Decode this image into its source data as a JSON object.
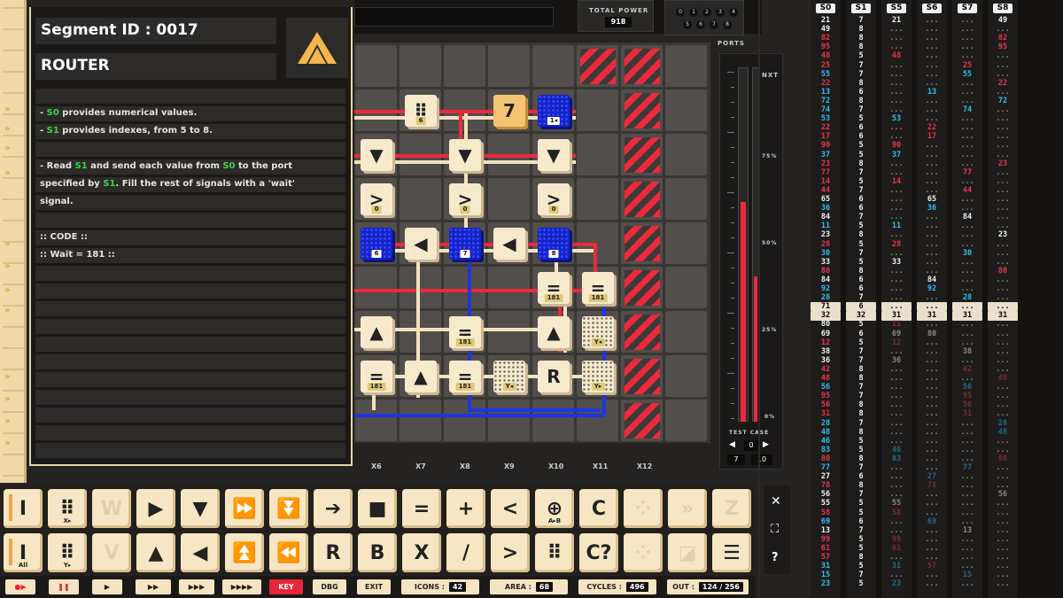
{
  "info": {
    "segment": "Segment ID : 0017",
    "name": "ROUTER",
    "lines": [
      {
        "pre": "- ",
        "g": "S0",
        "post": " provides numerical values."
      },
      {
        "pre": "- ",
        "g": "S1",
        "post": " provides indexes, from 5 to 8."
      },
      {
        "pre": "- Read ",
        "g": "S1",
        "post": " and send each value from "
      },
      {
        "pre": "specified by ",
        "g": "S1",
        "post": ". Fill the rest of signals with a 'wait'"
      },
      {
        "pre": "signal.",
        "g": "",
        "post": ""
      }
    ],
    "line3_g2": "S0",
    "line3_post2": " to the port",
    "code_header": ":: CODE ::",
    "code_line": ":: Wait = 181 ::"
  },
  "top": {
    "total_power_label": "TOTAL POWER",
    "total_power": "918",
    "ports_label": "PORTS",
    "port_digits": [
      "0",
      "1",
      "2",
      "3",
      "4",
      "5",
      "6",
      "7",
      "8"
    ]
  },
  "grid": {
    "columns": [
      "X6",
      "X7",
      "X8",
      "X9",
      "X10",
      "X11",
      "X12"
    ],
    "tiles": [
      {
        "id": "t1",
        "glyph": "⠿",
        "sub": "6",
        "cls": "",
        "c": 1,
        "r": 1
      },
      {
        "id": "t2",
        "glyph": "7",
        "sub": "",
        "cls": "orange",
        "c": 3,
        "r": 1
      },
      {
        "id": "t3",
        "glyph": "",
        "sub": "1◂",
        "cls": "blue",
        "c": 4,
        "r": 1
      },
      {
        "id": "t4",
        "glyph": "▼",
        "sub": "",
        "cls": "",
        "c": 0,
        "r": 2
      },
      {
        "id": "t5",
        "glyph": "▼",
        "sub": "",
        "cls": "",
        "c": 2,
        "r": 2
      },
      {
        "id": "t6",
        "glyph": "▼",
        "sub": "",
        "cls": "",
        "c": 4,
        "r": 2
      },
      {
        "id": "t7",
        "glyph": ">",
        "sub": "0",
        "cls": "",
        "c": 0,
        "r": 3
      },
      {
        "id": "t8",
        "glyph": ">",
        "sub": "0",
        "cls": "",
        "c": 2,
        "r": 3
      },
      {
        "id": "t9",
        "glyph": ">",
        "sub": "0",
        "cls": "",
        "c": 4,
        "r": 3
      },
      {
        "id": "t10",
        "glyph": "",
        "sub": "6",
        "cls": "blue",
        "c": 0,
        "r": 4
      },
      {
        "id": "t11",
        "glyph": "◀",
        "sub": "",
        "cls": "",
        "c": 1,
        "r": 4
      },
      {
        "id": "t12",
        "glyph": "",
        "sub": "7",
        "cls": "blue",
        "c": 2,
        "r": 4
      },
      {
        "id": "t13",
        "glyph": "◀",
        "sub": "",
        "cls": "",
        "c": 3,
        "r": 4
      },
      {
        "id": "t14",
        "glyph": "",
        "sub": "8",
        "cls": "blue",
        "c": 4,
        "r": 4
      },
      {
        "id": "t15",
        "glyph": "=",
        "sub": "181",
        "cls": "",
        "c": 4,
        "r": 5
      },
      {
        "id": "t16",
        "glyph": "=",
        "sub": "181",
        "cls": "",
        "c": 5,
        "r": 5
      },
      {
        "id": "t17",
        "glyph": "▲",
        "sub": "",
        "cls": "",
        "c": 0,
        "r": 6
      },
      {
        "id": "t18",
        "glyph": "=",
        "sub": "181",
        "cls": "",
        "c": 2,
        "r": 6
      },
      {
        "id": "t19",
        "glyph": "▲",
        "sub": "",
        "cls": "",
        "c": 4,
        "r": 6
      },
      {
        "id": "t20",
        "glyph": "",
        "sub": "Y◂",
        "cls": "dots",
        "c": 5,
        "r": 6
      },
      {
        "id": "t21",
        "glyph": "=",
        "sub": "181",
        "cls": "",
        "c": 0,
        "r": 7
      },
      {
        "id": "t22",
        "glyph": "▲",
        "sub": "",
        "cls": "",
        "c": 1,
        "r": 7
      },
      {
        "id": "t23",
        "glyph": "=",
        "sub": "181",
        "cls": "",
        "c": 2,
        "r": 7
      },
      {
        "id": "t24",
        "glyph": "",
        "sub": "Y◂",
        "cls": "dots",
        "c": 3,
        "r": 7
      },
      {
        "id": "t25",
        "glyph": "R",
        "sub": "",
        "cls": "",
        "c": 4,
        "r": 7
      },
      {
        "id": "t26",
        "glyph": "",
        "sub": "Y▸",
        "cls": "dots",
        "c": 5,
        "r": 7
      }
    ]
  },
  "gauge": {
    "label": "NXT",
    "ticks": [
      "75%",
      "50%",
      "25%",
      "0%"
    ],
    "fill": 0.62,
    "fill2": 0.41,
    "test_case_label": "TEST CASE",
    "test_case": "0",
    "tc_a": "7",
    "tc_b": "10"
  },
  "signals": [
    {
      "h": "S0",
      "v": [
        [
          "21",
          "w"
        ],
        [
          "49",
          "w"
        ],
        [
          "82",
          "r"
        ],
        [
          "95",
          "r"
        ],
        [
          "48",
          "r"
        ],
        [
          "25",
          "r"
        ],
        [
          "55",
          "c"
        ],
        [
          "22",
          "r"
        ],
        [
          "13",
          "c"
        ],
        [
          "72",
          "c"
        ],
        [
          "74",
          "c"
        ],
        [
          "53",
          "c"
        ],
        [
          "22",
          "r"
        ],
        [
          "17",
          "r"
        ],
        [
          "90",
          "r"
        ],
        [
          "37",
          "c"
        ],
        [
          "23",
          "r"
        ],
        [
          "77",
          "r"
        ],
        [
          "14",
          "r"
        ],
        [
          "44",
          "r"
        ],
        [
          "65",
          "w"
        ],
        [
          "36",
          "c"
        ],
        [
          "84",
          "w"
        ],
        [
          "11",
          "c"
        ],
        [
          "23",
          "w"
        ],
        [
          "28",
          "r"
        ],
        [
          "30",
          "c"
        ],
        [
          "33",
          "w"
        ],
        [
          "80",
          "r"
        ],
        [
          "84",
          "w"
        ],
        [
          "92",
          "c"
        ],
        [
          "28",
          "c"
        ],
        [
          "71",
          "box"
        ],
        [
          "32",
          "box"
        ],
        [
          "80",
          "w"
        ],
        [
          "69",
          "w"
        ],
        [
          "12",
          "r"
        ],
        [
          "38",
          "w"
        ],
        [
          "36",
          "w"
        ],
        [
          "42",
          "r"
        ],
        [
          "48",
          "r"
        ],
        [
          "56",
          "c"
        ],
        [
          "95",
          "r"
        ],
        [
          "56",
          "r"
        ],
        [
          "31",
          "r"
        ],
        [
          "28",
          "c"
        ],
        [
          "48",
          "c"
        ],
        [
          "46",
          "c"
        ],
        [
          "83",
          "c"
        ],
        [
          "80",
          "r"
        ],
        [
          "77",
          "c"
        ],
        [
          "27",
          "w"
        ],
        [
          "78",
          "r"
        ],
        [
          "56",
          "w"
        ],
        [
          "55",
          "w"
        ],
        [
          "58",
          "r"
        ],
        [
          "69",
          "c"
        ],
        [
          "13",
          "w"
        ],
        [
          "99",
          "r"
        ],
        [
          "61",
          "r"
        ],
        [
          "57",
          "r"
        ],
        [
          "31",
          "c"
        ],
        [
          "15",
          "c"
        ],
        [
          "23",
          "c"
        ]
      ]
    },
    {
      "h": "S1",
      "v": [
        [
          "7",
          "w"
        ],
        [
          "8",
          "w"
        ],
        [
          "8",
          "w"
        ],
        [
          "8",
          "w"
        ],
        [
          "5",
          "w"
        ],
        [
          "7",
          "w"
        ],
        [
          "7",
          "w"
        ],
        [
          "8",
          "w"
        ],
        [
          "6",
          "w"
        ],
        [
          "8",
          "w"
        ],
        [
          "7",
          "w"
        ],
        [
          "5",
          "w"
        ],
        [
          "6",
          "w"
        ],
        [
          "6",
          "w"
        ],
        [
          "5",
          "w"
        ],
        [
          "5",
          "w"
        ],
        [
          "8",
          "w"
        ],
        [
          "7",
          "w"
        ],
        [
          "5",
          "w"
        ],
        [
          "7",
          "w"
        ],
        [
          "6",
          "w"
        ],
        [
          "6",
          "w"
        ],
        [
          "7",
          "w"
        ],
        [
          "5",
          "w"
        ],
        [
          "8",
          "w"
        ],
        [
          "5",
          "w"
        ],
        [
          "7",
          "w"
        ],
        [
          "5",
          "w"
        ],
        [
          "8",
          "w"
        ],
        [
          "6",
          "w"
        ],
        [
          "6",
          "w"
        ],
        [
          "7",
          "w"
        ],
        [
          "6",
          "box"
        ],
        [
          "32",
          "box"
        ],
        [
          "5",
          "w"
        ],
        [
          "6",
          "w"
        ],
        [
          "5",
          "w"
        ],
        [
          "7",
          "w"
        ],
        [
          "7",
          "w"
        ],
        [
          "8",
          "w"
        ],
        [
          "8",
          "w"
        ],
        [
          "7",
          "w"
        ],
        [
          "7",
          "w"
        ],
        [
          "8",
          "w"
        ],
        [
          "8",
          "w"
        ],
        [
          "7",
          "w"
        ],
        [
          "8",
          "w"
        ],
        [
          "5",
          "w"
        ],
        [
          "5",
          "w"
        ],
        [
          "8",
          "w"
        ],
        [
          "7",
          "w"
        ],
        [
          "6",
          "w"
        ],
        [
          "8",
          "w"
        ],
        [
          "7",
          "w"
        ],
        [
          "5",
          "w"
        ],
        [
          "5",
          "w"
        ],
        [
          "6",
          "w"
        ],
        [
          "7",
          "w"
        ],
        [
          "5",
          "w"
        ],
        [
          "5",
          "w"
        ],
        [
          "8",
          "w"
        ],
        [
          "5",
          "w"
        ],
        [
          "7",
          "w"
        ],
        [
          "5",
          "w"
        ]
      ]
    }
  ],
  "signals_other": [
    {
      "h": "S5",
      "cur": "31",
      "rows": {
        "0": [
          "21",
          "w"
        ],
        "4": [
          "48",
          "r"
        ],
        "11": [
          "53",
          "c"
        ],
        "14": [
          "90",
          "r"
        ],
        "15": [
          "37",
          "c"
        ],
        "18": [
          "14",
          "r"
        ],
        "23": [
          "11",
          "c"
        ],
        "25": [
          "28",
          "r"
        ],
        "27": [
          "33",
          "w"
        ],
        "34": [
          "11",
          "dr"
        ],
        "35": [
          "69",
          "gr"
        ],
        "36": [
          "12",
          "dr"
        ],
        "38": [
          "36",
          "gr"
        ],
        "48": [
          "46",
          "dc"
        ],
        "49": [
          "83",
          "dc"
        ],
        "54": [
          "55",
          "gr"
        ],
        "55": [
          "58",
          "dr"
        ],
        "58": [
          "99",
          "dr"
        ],
        "59": [
          "61",
          "dr"
        ],
        "61": [
          "31",
          "dc"
        ],
        "63": [
          "23",
          "dc"
        ]
      }
    },
    {
      "h": "S6",
      "cur": "31",
      "rows": {
        "8": [
          "13",
          "c"
        ],
        "12": [
          "22",
          "r"
        ],
        "13": [
          "17",
          "r"
        ],
        "20": [
          "65",
          "w"
        ],
        "21": [
          "36",
          "c"
        ],
        "29": [
          "84",
          "w"
        ],
        "30": [
          "92",
          "c"
        ],
        "35": [
          "80",
          "gr"
        ],
        "51": [
          "27",
          "dc"
        ],
        "52": [
          "78",
          "dr"
        ],
        "56": [
          "69",
          "dc"
        ],
        "61": [
          "57",
          "dr"
        ]
      }
    },
    {
      "h": "S7",
      "cur": "31",
      "rows": {
        "5": [
          "25",
          "r"
        ],
        "6": [
          "55",
          "c"
        ],
        "10": [
          "74",
          "c"
        ],
        "17": [
          "77",
          "r"
        ],
        "19": [
          "44",
          "r"
        ],
        "22": [
          "84",
          "w"
        ],
        "26": [
          "30",
          "c"
        ],
        "31": [
          "28",
          "c"
        ],
        "37": [
          "38",
          "gr"
        ],
        "39": [
          "42",
          "dr"
        ],
        "41": [
          "56",
          "dc"
        ],
        "42": [
          "95",
          "dr"
        ],
        "43": [
          "56",
          "dr"
        ],
        "44": [
          "31",
          "dr"
        ],
        "50": [
          "77",
          "dc"
        ],
        "57": [
          "13",
          "gr"
        ],
        "62": [
          "15",
          "dc"
        ]
      }
    },
    {
      "h": "S8",
      "cur": "31",
      "rows": {
        "0": [
          "49",
          "w"
        ],
        "2": [
          "82",
          "r"
        ],
        "3": [
          "95",
          "r"
        ],
        "7": [
          "22",
          "r"
        ],
        "9": [
          "72",
          "c"
        ],
        "16": [
          "23",
          "r"
        ],
        "24": [
          "23",
          "w"
        ],
        "28": [
          "80",
          "r"
        ],
        "40": [
          "48",
          "dr"
        ],
        "45": [
          "28",
          "dc"
        ],
        "46": [
          "48",
          "dc"
        ],
        "49": [
          "80",
          "dr"
        ],
        "53": [
          "56",
          "gr"
        ]
      }
    }
  ],
  "palette": [
    [
      "I",
      "",
      "acc"
    ],
    [
      "⠿",
      "X▸",
      ""
    ],
    [
      "W",
      "",
      "dim"
    ],
    [
      "▶",
      "",
      ""
    ],
    [
      "▼",
      "",
      ""
    ],
    [
      "⏩",
      "",
      ""
    ],
    [
      "⏬",
      "",
      ""
    ],
    [
      "➔",
      "",
      ""
    ],
    [
      "■",
      "",
      ""
    ],
    [
      "=",
      "",
      ""
    ],
    [
      "+",
      "",
      ""
    ],
    [
      "<",
      "",
      ""
    ],
    [
      "⊕",
      "A▸B",
      ""
    ],
    [
      "C",
      "",
      ""
    ],
    [
      "⁘",
      "",
      "dim"
    ],
    [
      "»",
      "",
      "dim"
    ],
    [
      "Z",
      "",
      "dim"
    ],
    [
      "I",
      "All",
      "acc"
    ],
    [
      "⠿",
      "Y▸",
      ""
    ],
    [
      "V",
      "",
      "dim"
    ],
    [
      "▲",
      "",
      ""
    ],
    [
      "◀",
      "",
      ""
    ],
    [
      "⏫",
      "",
      ""
    ],
    [
      "⏪",
      "",
      ""
    ],
    [
      "R",
      "",
      ""
    ],
    [
      "B",
      "",
      ""
    ],
    [
      "X",
      "",
      ""
    ],
    [
      "/",
      "",
      ""
    ],
    [
      ">",
      "",
      ""
    ],
    [
      "⠿",
      "",
      ""
    ],
    [
      "C?",
      "",
      ""
    ],
    [
      "⁘",
      "",
      "dim"
    ],
    [
      "◪",
      "",
      "dim"
    ],
    [
      "☰",
      "",
      ""
    ]
  ],
  "bottom": {
    "key": "KEY",
    "dbg": "DBG",
    "exit": "EXIT",
    "icons_label": "ICONS :",
    "icons": "42",
    "area_label": "AREA :",
    "area": "68",
    "cycles_label": "CYCLES :",
    "cycles": "496",
    "out_label": "OUT :",
    "out": "124 / 256"
  },
  "colors": {
    "red": "#ec2a3c",
    "blue": "#1424c8",
    "cream": "#f7eacc",
    "green": "#3fd14a",
    "cyan": "#2fbff0"
  }
}
